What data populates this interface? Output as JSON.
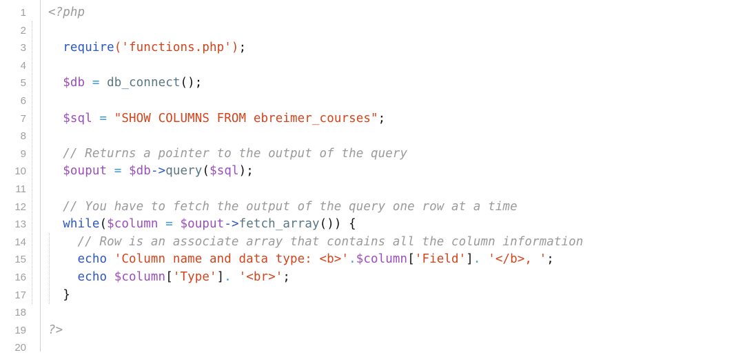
{
  "editor": {
    "language": "php",
    "background": "#ffffff",
    "gutter_color": "#9e9e9e",
    "rule_color": "#cfcfcf",
    "indent_guide_color": "#c6c6c6",
    "line_numbers": [
      "1",
      "2",
      "3",
      "4",
      "5",
      "6",
      "7",
      "8",
      "9",
      "10",
      "11",
      "12",
      "13",
      "14",
      "15",
      "16",
      "17",
      "18",
      "19",
      "20"
    ],
    "colors": {
      "tag": "#9a9a9a",
      "comment": "#9a9a9a",
      "keyword": "#2b56c4",
      "function": "#5a7682",
      "variable": "#9a4dbb",
      "string": "#d5431c",
      "operator": "#3b9ad4",
      "arrow": "#2b56c4",
      "punctuation": "#111111"
    },
    "lines": [
      {
        "n": "1",
        "text": "<?php"
      },
      {
        "n": "2",
        "text": ""
      },
      {
        "n": "3",
        "text": "  require('functions.php');"
      },
      {
        "n": "4",
        "text": ""
      },
      {
        "n": "5",
        "text": "  $db = db_connect();"
      },
      {
        "n": "6",
        "text": ""
      },
      {
        "n": "7",
        "text": "  $sql = \"SHOW COLUMNS FROM ebreimer_courses\";"
      },
      {
        "n": "8",
        "text": ""
      },
      {
        "n": "9",
        "text": "  // Returns a pointer to the output of the query"
      },
      {
        "n": "10",
        "text": "  $ouput = $db->query($sql);"
      },
      {
        "n": "11",
        "text": ""
      },
      {
        "n": "12",
        "text": "  // You have to fetch the output of the query one row at a time"
      },
      {
        "n": "13",
        "text": "  while($column = $ouput->fetch_array()) {"
      },
      {
        "n": "14",
        "text": "    // Row is an associate array that contains all the column information"
      },
      {
        "n": "15",
        "text": "    echo 'Column name and data type: <b>'.$column['Field']. '</b>, ';"
      },
      {
        "n": "16",
        "text": "    echo $column['Type']. '<br>';"
      },
      {
        "n": "17",
        "text": "  }"
      },
      {
        "n": "18",
        "text": ""
      },
      {
        "n": "19",
        "text": "?>"
      },
      {
        "n": "20",
        "text": ""
      }
    ],
    "tokens": {
      "l1_tag": "<?php",
      "l3_indent": "  ",
      "l3_fn": "require",
      "l3_paren_open": "(",
      "l3_str": "'functions.php'",
      "l3_paren_close": ")",
      "l3_semi": ";",
      "l5_var": "$db",
      "l5_eq": "=",
      "l5_fn": "db_connect",
      "l5_tail": "();",
      "l7_var": "$sql",
      "l7_eq": "=",
      "l7_str": "\"SHOW COLUMNS FROM ebreimer_courses\"",
      "l7_semi": ";",
      "l9_cmt": "// Returns a pointer to the output of the query",
      "l10_var1": "$ouput",
      "l10_eq": "=",
      "l10_var2": "$db",
      "l10_arrow": "->",
      "l10_fn": "query",
      "l10_p1": "(",
      "l10_var3": "$sql",
      "l10_p2": ");",
      "l12_cmt": "// You have to fetch the output of the query one row at a time",
      "l13_kw": "while",
      "l13_p1": "(",
      "l13_var1": "$column",
      "l13_eq": "=",
      "l13_var2": "$ouput",
      "l13_arrow": "->",
      "l13_fn": "fetch_array",
      "l13_p2": "()) {",
      "l14_cmt": "// Row is an associate array that contains all the column information",
      "l15_kw": "echo",
      "l15_str1": "'Column name and data type: <b>'",
      "l15_dot1": ".",
      "l15_var": "$column",
      "l15_br1": "[",
      "l15_str2": "'Field'",
      "l15_br2": "]",
      "l15_dot2": ".",
      "l15_str3": " '</b>, '",
      "l15_semi": ";",
      "l16_kw": "echo",
      "l16_var": "$column",
      "l16_br1": "[",
      "l16_str1": "'Type'",
      "l16_br2": "]",
      "l16_dot": ".",
      "l16_str2": " '<br>'",
      "l16_semi": ";",
      "l17_brace": "}",
      "l19_tag": "?>"
    }
  }
}
